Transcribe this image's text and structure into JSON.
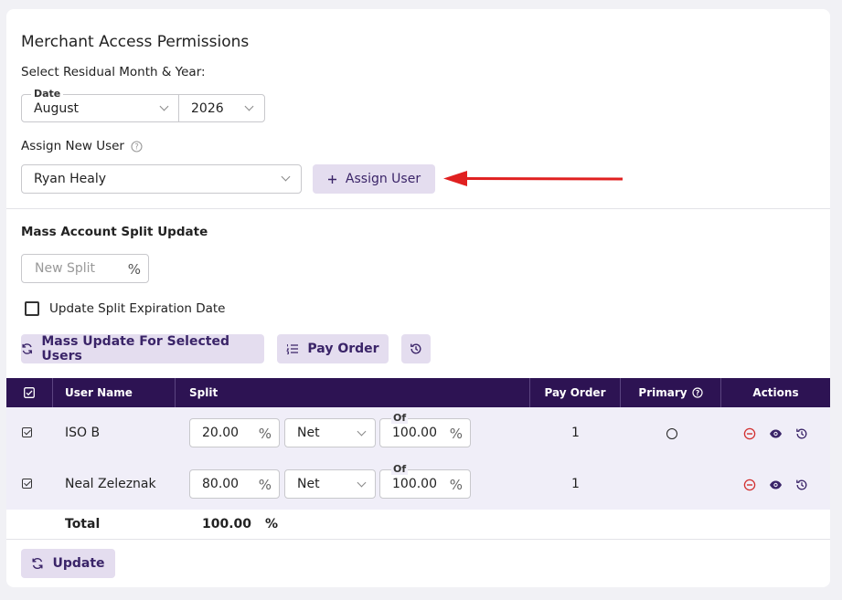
{
  "page": {
    "title": "Merchant Access Permissions",
    "residual_label": "Select Residual Month & Year:",
    "date_label": "Date",
    "month_value": "August",
    "year_value": "2026",
    "assign_label": "Assign New User",
    "assign_user_value": "Ryan Healy",
    "assign_button": "Assign User",
    "mass_title": "Mass Account Split Update",
    "new_split_placeholder": "New Split",
    "percent_sign": "%",
    "expiration_label": "Update Split Expiration Date",
    "mass_update_button": "Mass Update For Selected Users",
    "pay_order_button": "Pay Order",
    "update_button": "Update"
  },
  "table": {
    "headers": {
      "user_name": "User Name",
      "split": "Split",
      "pay_order": "Pay Order",
      "primary": "Primary",
      "actions": "Actions"
    },
    "of_label": "Of",
    "rows": [
      {
        "user": "ISO B",
        "split": "20.00",
        "basis": "Net",
        "of": "100.00",
        "pay_order": "1",
        "selected": true,
        "primary": false
      },
      {
        "user": "Neal Zeleznak",
        "split": "80.00",
        "basis": "Net",
        "of": "100.00",
        "pay_order": "1",
        "selected": true,
        "primary": false
      }
    ],
    "total_label": "Total",
    "total_value": "100.00",
    "total_unit": "%"
  },
  "colors": {
    "header_bg": "#2d1353",
    "button_bg": "#e4ddef",
    "button_text": "#3a2468",
    "annotation_arrow": "#e02020",
    "row_bg": "#f0eef8"
  },
  "icons": [
    "help-circle-icon",
    "plus-icon",
    "refresh-icon",
    "list-order-icon",
    "history-icon",
    "minus-circle-icon",
    "eye-icon",
    "checkbox-icon"
  ]
}
